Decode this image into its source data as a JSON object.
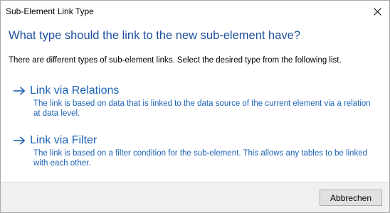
{
  "window": {
    "title": "Sub-Element Link Type"
  },
  "main_instruction": "What type should the link to the new sub-element have?",
  "content": "There are different types of sub-element links. Select the desired type from the following list.",
  "options": [
    {
      "icon": "arrow-right-icon",
      "title": "Link via Relations",
      "description_lines": [
        "The link is based on data that is linked to the data source of the current element via a relation",
        "at data level."
      ]
    },
    {
      "icon": "arrow-right-icon",
      "title": "Link via Filter",
      "description_lines": [
        "The link is based on a filter condition for the sub-element. This allows any tables to be linked",
        "with each other."
      ]
    }
  ],
  "footer": {
    "cancel_label": "Abbrechen"
  },
  "colors": {
    "instruction": "#1d4f9e",
    "link": "#1c62b5",
    "footer_bg": "#f0f0f0"
  }
}
